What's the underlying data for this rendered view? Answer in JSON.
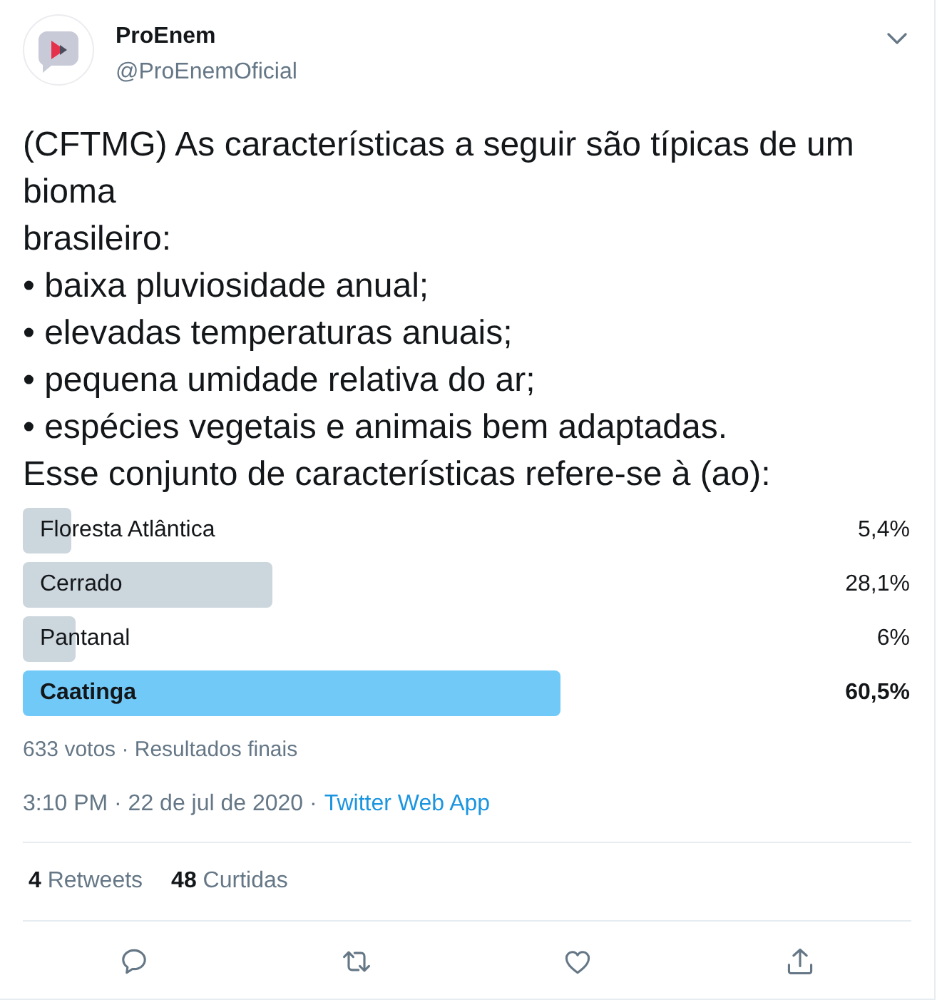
{
  "author": {
    "name": "ProEnem",
    "handle": "@ProEnemOficial"
  },
  "tweet": {
    "text": "(CFTMG) As características a seguir são típicas de um bioma\nbrasileiro:\n• baixa pluviosidade anual;\n• elevadas temperaturas anuais;\n• pequena umidade relativa do ar;\n• espécies vegetais e animais bem adaptadas.\nEsse conjunto de características refere-se à (ao):"
  },
  "poll": {
    "options": [
      {
        "label": "Floresta Atlântica",
        "share": "5,4%",
        "level": 0.054,
        "winner": false
      },
      {
        "label": "Cerrado",
        "share": "28,1%",
        "level": 0.281,
        "winner": false
      },
      {
        "label": "Pantanal",
        "share": "6%",
        "level": 0.06,
        "winner": false
      },
      {
        "label": "Caatinga",
        "share": "60,5%",
        "level": 0.605,
        "winner": true
      }
    ],
    "summary": "633 votos · Resultados finais"
  },
  "meta": {
    "timestamp": "3:10 PM · 22 de jul de 2020 ·",
    "source": "Twitter Web App"
  },
  "stats": [
    "**4** Retweets",
    "**48** Curtidas"
  ]
}
